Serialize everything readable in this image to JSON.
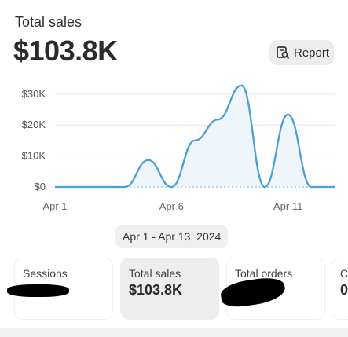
{
  "header": {
    "title": "Total sales",
    "total_value": "$103.8K",
    "report_label": "Report",
    "report_icon": "report-search-icon"
  },
  "chart_data": {
    "type": "area",
    "x_ticks": [
      "Apr 1",
      "Apr 6",
      "Apr 11"
    ],
    "y_ticks": [
      "$30K",
      "$20K",
      "$10K",
      "$0"
    ],
    "ylim": [
      0,
      33000
    ],
    "x": [
      "Apr 1",
      "Apr 2",
      "Apr 3",
      "Apr 4",
      "Apr 5",
      "Apr 6",
      "Apr 7",
      "Apr 8",
      "Apr 9",
      "Apr 10",
      "Apr 11",
      "Apr 12",
      "Apr 13"
    ],
    "series": [
      {
        "values": [
          0,
          0,
          0,
          0,
          8700,
          0,
          15000,
          21800,
          32800,
          0,
          23400,
          0,
          0
        ]
      }
    ],
    "colors": {
      "line": "#4a9fd4",
      "fill": "#eef5fb",
      "grid": "#e6e6e6",
      "baseline": "#9ec9ea"
    }
  },
  "date_range": "Apr 1 - Apr 13, 2024",
  "metrics": [
    {
      "label": "Sessions",
      "value": ""
    },
    {
      "label": "Total sales",
      "value": "$103.8K"
    },
    {
      "label": "Total orders",
      "value": ""
    },
    {
      "label": "C",
      "value": "0"
    }
  ]
}
